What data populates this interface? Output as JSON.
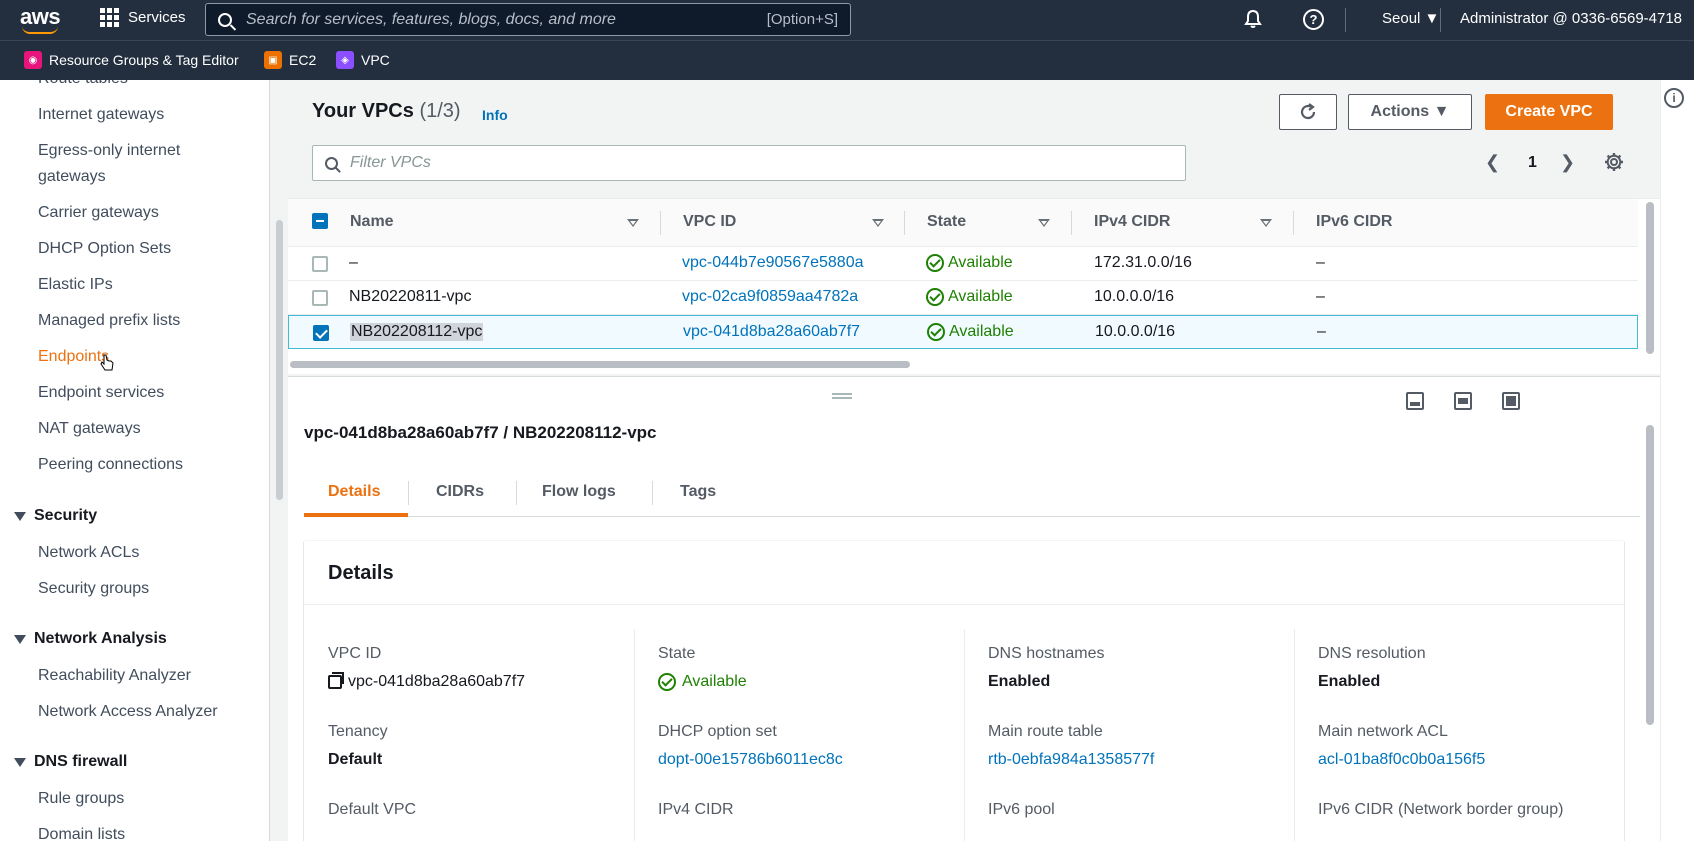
{
  "topnav": {
    "logo": "aws",
    "services_label": "Services",
    "search_placeholder": "Search for services, features, blogs, docs, and more",
    "search_shortcut": "[Option+S]",
    "region": "Seoul ▼",
    "account": "Administrator @ 0336-6569-4718"
  },
  "favorites": [
    {
      "label": "Resource Groups & Tag Editor",
      "color": "#e7157b"
    },
    {
      "label": "EC2",
      "color": "#ed7100"
    },
    {
      "label": "VPC",
      "color": "#8c4fff"
    }
  ],
  "sidebar": {
    "items": [
      {
        "label": "Route tables"
      },
      {
        "label": "Internet gateways"
      },
      {
        "label": "Egress-only internet"
      },
      {
        "label": "gateways"
      },
      {
        "label": "Carrier gateways"
      },
      {
        "label": "DHCP Option Sets"
      },
      {
        "label": "Elastic IPs"
      },
      {
        "label": "Managed prefix lists"
      },
      {
        "label": "Endpoints"
      },
      {
        "label": "Endpoint services"
      },
      {
        "label": "NAT gateways"
      },
      {
        "label": "Peering connections"
      }
    ],
    "sections": [
      {
        "title": "Security",
        "items": [
          "Network ACLs",
          "Security groups"
        ]
      },
      {
        "title": "Network Analysis",
        "items": [
          "Reachability Analyzer",
          "Network Access Analyzer"
        ]
      },
      {
        "title": "DNS firewall",
        "items": [
          "Rule groups",
          "Domain lists"
        ]
      }
    ]
  },
  "main": {
    "title": "Your VPCs",
    "count": "(1/3)",
    "info": "Info",
    "actions_label": "Actions ▼",
    "create_label": "Create VPC",
    "filter_placeholder": "Filter VPCs",
    "page": "1",
    "columns": [
      "Name",
      "VPC ID",
      "State",
      "IPv4 CIDR",
      "IPv6 CIDR"
    ],
    "rows": [
      {
        "name": "–",
        "vpc_id": "vpc-044b7e90567e5880a",
        "state": "Available",
        "ipv4": "172.31.0.0/16",
        "ipv6": "–",
        "checked": false
      },
      {
        "name": "NB20220811-vpc",
        "vpc_id": "vpc-02ca9f0859aa4782a",
        "state": "Available",
        "ipv4": "10.0.0.0/16",
        "ipv6": "–",
        "checked": false
      },
      {
        "name": "NB202208112-vpc",
        "vpc_id": "vpc-041d8ba28a60ab7f7",
        "state": "Available",
        "ipv4": "10.0.0.0/16",
        "ipv6": "–",
        "checked": true
      }
    ]
  },
  "split": {
    "title": "vpc-041d8ba28a60ab7f7 / NB202208112-vpc",
    "tabs": [
      "Details",
      "CIDRs",
      "Flow logs",
      "Tags"
    ],
    "details_heading": "Details",
    "fields": [
      {
        "key": "VPC ID",
        "value": "vpc-041d8ba28a60ab7f7"
      },
      {
        "key": "State",
        "value": "Available"
      },
      {
        "key": "DNS hostnames",
        "value": "Enabled"
      },
      {
        "key": "DNS resolution",
        "value": "Enabled"
      },
      {
        "key": "Tenancy",
        "value": "Default"
      },
      {
        "key": "DHCP option set",
        "value": "dopt-00e15786b6011ec8c"
      },
      {
        "key": "Main route table",
        "value": "rtb-0ebfa984a1358577f"
      },
      {
        "key": "Main network ACL",
        "value": "acl-01ba8f0c0b0a156f5"
      },
      {
        "key": "Default VPC",
        "value": ""
      },
      {
        "key": "IPv4 CIDR",
        "value": ""
      },
      {
        "key": "IPv6 pool",
        "value": ""
      },
      {
        "key": "IPv6 CIDR (Network border group)",
        "value": ""
      }
    ]
  }
}
